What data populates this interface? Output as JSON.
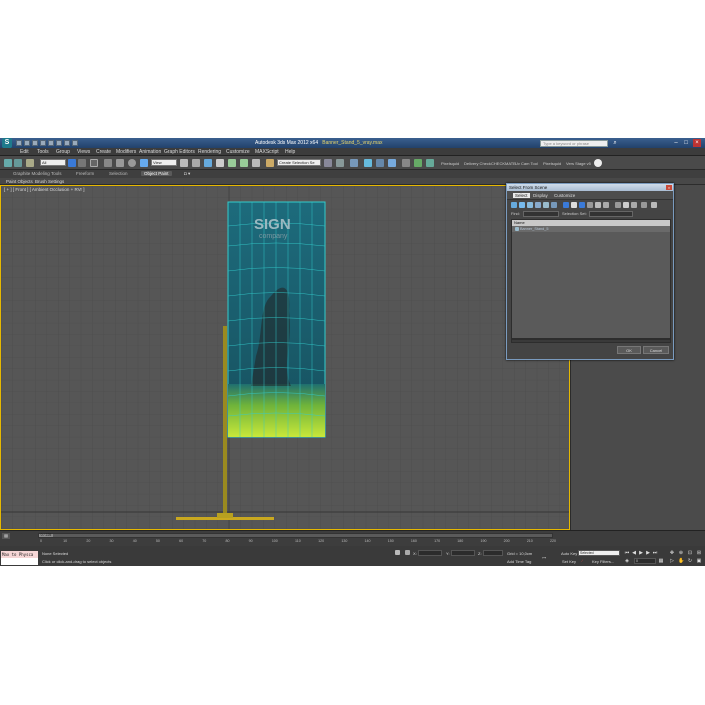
{
  "window": {
    "app_title": "Autodesk 3ds Max 2012 x64",
    "file_title": "Banner_Stand_5_vray.max",
    "search_placeholder": "Type a keyword or phrase"
  },
  "menu": [
    "Edit",
    "Tools",
    "Group",
    "Views",
    "Create",
    "Modifiers",
    "Animation",
    "Graph Editors",
    "Rendering",
    "Customize",
    "MAXScript",
    "Help"
  ],
  "toolbar": {
    "filter_value": "All",
    "view_value": "View",
    "named_selection": "Create Selection Se",
    "right_labels": [
      "Pixelsquid",
      "Delivery Check",
      "CHECKMATE",
      "Uv Cam Tool",
      "Pixelsquid",
      "Vers Stage v5"
    ]
  },
  "ribbon": {
    "tabs": [
      "Graphite Modeling Tools",
      "Freeform",
      "Selection",
      "Object Paint"
    ],
    "active_tab": "Object Paint",
    "subtabs": [
      "Paint Objects",
      "Brush Settings"
    ]
  },
  "viewport": {
    "label": "[ + ] [ Front ] [ Ambient Occlusion + RVr ]",
    "banner_title": "SIGN",
    "banner_sub": "company"
  },
  "dialog": {
    "title": "Select From Scene",
    "menu": [
      "Select",
      "Display",
      "Customize"
    ],
    "active_menu": "Select",
    "find_label": "Find:",
    "selection_set_label": "Selection Set:",
    "column_name": "Name",
    "objects": [
      "Banner_Stand_5"
    ],
    "ok": "OK",
    "cancel": "Cancel"
  },
  "timeline": {
    "frame_display": "0 / 225",
    "ticks": [
      "0",
      "10",
      "20",
      "30",
      "40",
      "50",
      "60",
      "70",
      "80",
      "90",
      "100",
      "110",
      "120",
      "130",
      "140",
      "150",
      "160",
      "170",
      "180",
      "190",
      "200",
      "210",
      "220"
    ]
  },
  "status": {
    "maxscript_text": "Max to Physca",
    "selection": "None Selected",
    "prompt": "Click or click-and-drag to select objects",
    "x_label": "X:",
    "y_label": "Y:",
    "z_label": "Z:",
    "grid": "Grid = 10,0cm",
    "add_time_tag": "Add Time Tag",
    "auto_key": "Auto Key",
    "auto_key_value": "Selected",
    "set_key": "Set Key",
    "key_filters": "Key Filters...",
    "current_frame": "0"
  },
  "colors": {
    "viewport_bg": "#565656",
    "active_border": "#e6b800",
    "banner_wire": "#33cccc",
    "grass": "#9acd32"
  }
}
